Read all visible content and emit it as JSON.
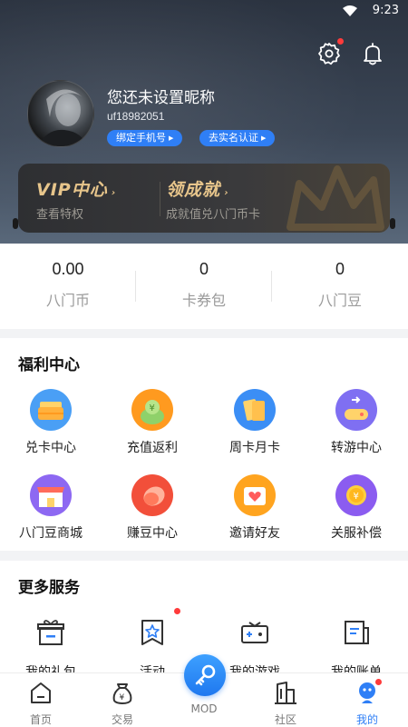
{
  "status_bar": {
    "time": "9:23"
  },
  "profile": {
    "nickname": "您还未设置昵称",
    "uid": "uf18982051",
    "bind_phone_label": "绑定手机号",
    "verify_label": "去实名认证"
  },
  "vip": {
    "left_title": "VIP中心",
    "left_sub": "查看特权",
    "right_title": "领成就",
    "right_sub": "成就值兑八门币卡"
  },
  "stats": [
    {
      "value": "0.00",
      "label": "八门币"
    },
    {
      "value": "0",
      "label": "卡券包"
    },
    {
      "value": "0",
      "label": "八门豆"
    }
  ],
  "welfare": {
    "title": "福利中心",
    "items": [
      {
        "label": "兑卡中心",
        "icon": "card-exchange-icon",
        "color": "#4a9ff5"
      },
      {
        "label": "充值返利",
        "icon": "recharge-rebate-icon",
        "color": "#ff9a1f"
      },
      {
        "label": "周卡月卡",
        "icon": "week-month-card-icon",
        "color": "#3b8ef5"
      },
      {
        "label": "转游中心",
        "icon": "game-transfer-icon",
        "color": "#7f6ff2"
      },
      {
        "label": "八门豆商城",
        "icon": "bean-mall-icon",
        "color": "#8d68f2"
      },
      {
        "label": "赚豆中心",
        "icon": "earn-beans-icon",
        "color": "#f24f3a"
      },
      {
        "label": "邀请好友",
        "icon": "invite-friends-icon",
        "color": "#ffa41f"
      },
      {
        "label": "关服补偿",
        "icon": "server-compensation-icon",
        "color": "#8b5cf0"
      }
    ]
  },
  "more_services": {
    "title": "更多服务",
    "items": [
      {
        "label": "我的礼包",
        "icon": "gift-box-icon"
      },
      {
        "label": "活动",
        "icon": "activity-star-icon"
      },
      {
        "label": "我的游戏",
        "icon": "game-controller-icon"
      },
      {
        "label": "我的账单",
        "icon": "bill-icon"
      }
    ]
  },
  "tabbar": {
    "items": [
      {
        "label": "首页",
        "icon": "home-icon"
      },
      {
        "label": "交易",
        "icon": "trade-bag-icon"
      },
      {
        "label": "MOD",
        "icon": "key-icon"
      },
      {
        "label": "社区",
        "icon": "community-building-icon"
      },
      {
        "label": "我的",
        "icon": "profile-robot-icon"
      }
    ],
    "active_color": "#2f7ff6"
  }
}
